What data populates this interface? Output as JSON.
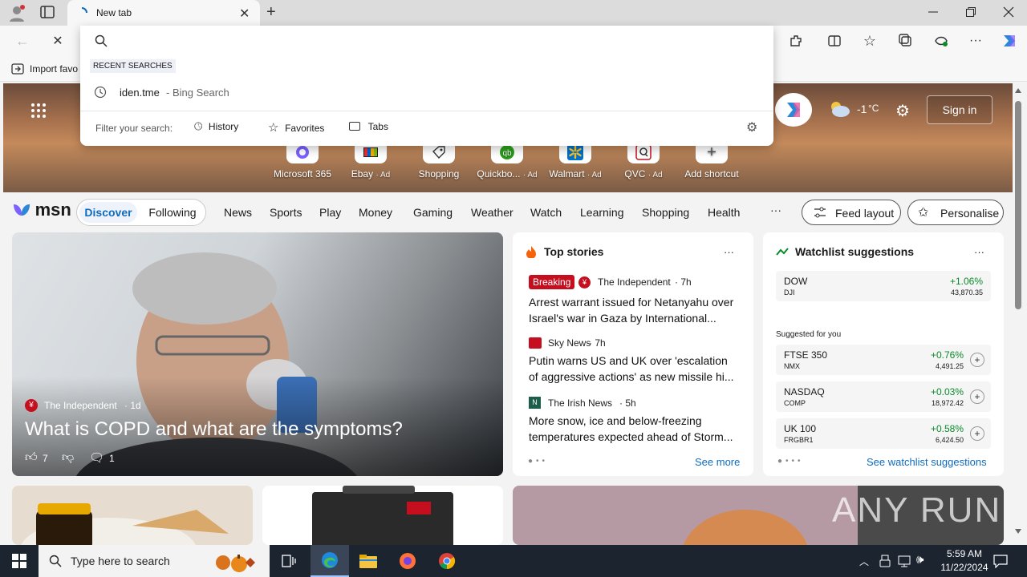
{
  "tabs": [
    {
      "title": "New tab"
    }
  ],
  "favorites": {
    "import_label": "Import favo"
  },
  "address": {
    "value": "",
    "placeholder": ""
  },
  "suggestions": {
    "header": "RECENT SEARCHES",
    "items": [
      {
        "query": "iden.tme",
        "source": "- Bing Search"
      }
    ],
    "filter_label": "Filter your search:",
    "filters": [
      {
        "label": "History"
      },
      {
        "label": "Favorites"
      },
      {
        "label": "Tabs"
      }
    ]
  },
  "weather": {
    "temp": "-1",
    "unit": "°C"
  },
  "signin_label": "Sign in",
  "shortcuts": [
    {
      "label": "Microsoft 365",
      "ad": ""
    },
    {
      "label": "Ebay",
      "ad": "· Ad"
    },
    {
      "label": "Shopping",
      "ad": ""
    },
    {
      "label": "Quickbo...",
      "ad": "· Ad"
    },
    {
      "label": "Walmart",
      "ad": "· Ad"
    },
    {
      "label": "QVC",
      "ad": "· Ad"
    },
    {
      "label": "Add shortcut",
      "ad": ""
    }
  ],
  "msn": {
    "logo": "msn",
    "tabs": [
      {
        "label": "Discover"
      },
      {
        "label": "Following"
      }
    ],
    "nav": [
      "News",
      "Sports",
      "Play",
      "Money",
      "Gaming",
      "Weather",
      "Watch",
      "Learning",
      "Shopping",
      "Health"
    ],
    "more": "···",
    "feed_layout": "Feed layout",
    "personalise": "Personalise"
  },
  "hero_story": {
    "source": "The Independent",
    "age": "· 1d",
    "title": "What is COPD and what are the symptoms?",
    "likes": "7",
    "comments": "1"
  },
  "top_stories": {
    "title": "Top stories",
    "more": "···",
    "items": [
      {
        "badge": "Breaking",
        "source": "The Independent",
        "age": "· 7h",
        "headline": "Arrest warrant issued for Netanyahu over Israel's war in Gaza by International..."
      },
      {
        "badge": "",
        "source": "Sky News",
        "age": "· 7h",
        "headline": "Putin warns US and UK over 'escalation of aggressive actions' as new missile hi..."
      },
      {
        "badge": "",
        "source": "The Irish News",
        "age": "· 5h",
        "headline": "More snow, ice and below-freezing temperatures expected ahead of Storm..."
      }
    ],
    "see_more": "See more"
  },
  "watchlist": {
    "title": "Watchlist suggestions",
    "more": "···",
    "main": {
      "name": "DOW",
      "symbol": "DJI",
      "change": "+1.06%",
      "value": "43,870.35"
    },
    "suggested_label": "Suggested for you",
    "items": [
      {
        "name": "FTSE 350",
        "symbol": "NMX",
        "change": "+0.76%",
        "value": "4,491.25"
      },
      {
        "name": "NASDAQ",
        "symbol": "COMP",
        "change": "+0.03%",
        "value": "18,972.42"
      },
      {
        "name": "UK 100",
        "symbol": "FRGBR1",
        "change": "+0.58%",
        "value": "6,424.50"
      }
    ],
    "see_more": "See watchlist suggestions"
  },
  "watermark": "ANY RUN",
  "taskbar": {
    "search_placeholder": "Type here to search",
    "time": "5:59 AM",
    "date": "11/22/2024"
  },
  "colors": {
    "accent": "#0f6cbd",
    "positive": "#0a8a2a",
    "breaking": "#c50f1f",
    "taskbar": "#1c2430"
  }
}
